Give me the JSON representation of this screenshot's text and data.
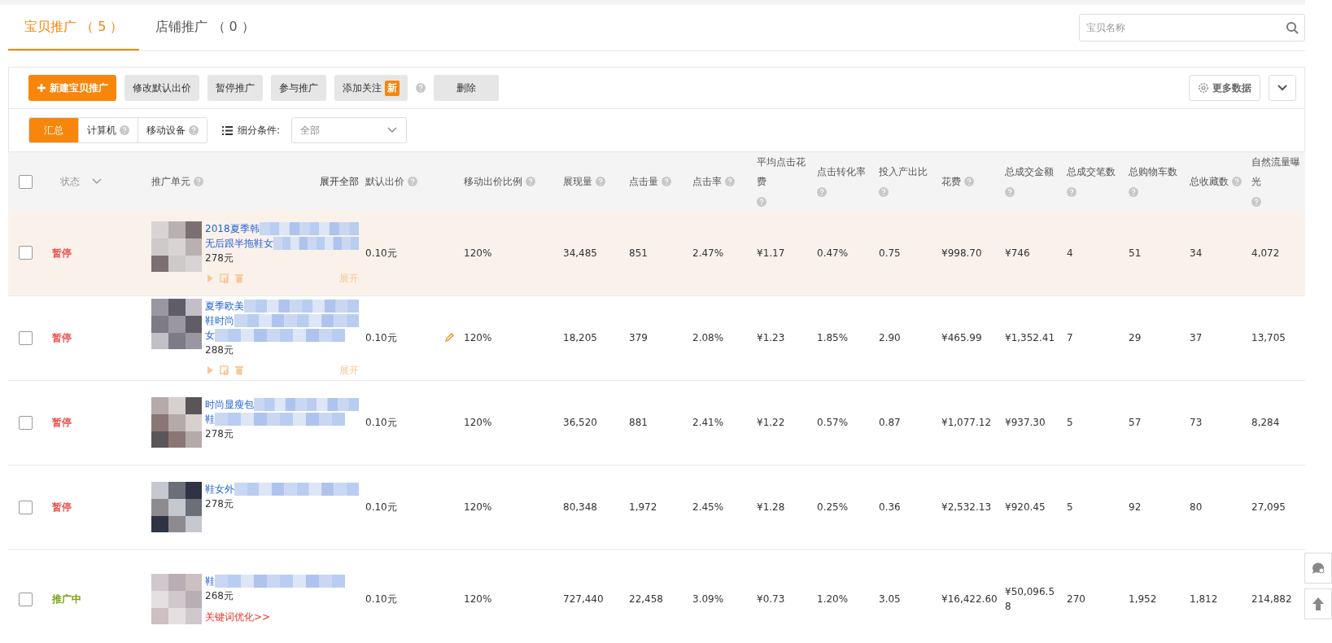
{
  "tabs": [
    {
      "label": "宝贝推广 （ 5 ）",
      "selected": true
    },
    {
      "label": "店铺推广 （ 0 ）",
      "selected": false
    }
  ],
  "search": {
    "placeholder": "宝贝名称"
  },
  "toolbar": {
    "buttons": [
      {
        "label": "新建宝贝推广",
        "kind": "primary"
      },
      {
        "label": "修改默认出价",
        "kind": "plain"
      },
      {
        "label": "暂停推广",
        "kind": "plain"
      },
      {
        "label": "参与推广",
        "kind": "plain"
      },
      {
        "label": "添加关注",
        "kind": "plain",
        "badge": "新",
        "help": true
      },
      {
        "label": "删除",
        "kind": "wide"
      }
    ],
    "more_data": "更多数据"
  },
  "segments": [
    {
      "label": "汇总",
      "selected": true,
      "help": false
    },
    {
      "label": "计算机",
      "selected": false,
      "help": true
    },
    {
      "label": "移动设备",
      "selected": false,
      "help": true
    }
  ],
  "filter": {
    "label": "细分条件:",
    "value": "全部"
  },
  "select_all": {
    "checked": false
  },
  "columns": [
    {
      "label": "状态",
      "kind": "status"
    },
    {
      "label": "推广单元",
      "kind": "unit",
      "help": true,
      "link": "展开全部"
    },
    {
      "label": "默认出价",
      "help": true
    },
    {
      "label": "移动出价比例",
      "help": true
    },
    {
      "label": "展现量",
      "help": true
    },
    {
      "label": "点击量",
      "help": true
    },
    {
      "label": "点击率",
      "help": true
    },
    {
      "label": "平均点击花费",
      "help": true
    },
    {
      "label": "点击转化率",
      "help": true
    },
    {
      "label": "投入产出比",
      "help": true
    },
    {
      "label": "花费",
      "help": true
    },
    {
      "label": "总成交金额",
      "help": true
    },
    {
      "label": "总成交笔数",
      "help": true
    },
    {
      "label": "总购物车数",
      "help": true
    },
    {
      "label": "总收藏数",
      "help": true
    },
    {
      "label": "自然流量曝光",
      "help": true
    }
  ],
  "rows": [
    {
      "checked": false,
      "highlighted": true,
      "status": "暂停",
      "active": false,
      "title_lines": [
        "2018夏季韩",
        "无后跟半拖鞋女"
      ],
      "price": "278元",
      "actions": true,
      "expand": "展开",
      "edit": false,
      "cells": [
        "0.10元",
        "120%",
        "34,485",
        "851",
        "2.47%",
        "¥1.17",
        "0.47%",
        "0.75",
        "¥998.70",
        "¥746",
        "4",
        "51",
        "34",
        "4,072"
      ]
    },
    {
      "checked": false,
      "highlighted": false,
      "status": "暂停",
      "active": false,
      "title_lines": [
        "夏季欧美",
        "鞋时尚",
        "女"
      ],
      "price": "288元",
      "actions": true,
      "expand": "展开",
      "edit": true,
      "cells": [
        "0.10元",
        "120%",
        "18,205",
        "379",
        "2.08%",
        "¥1.23",
        "1.85%",
        "2.90",
        "¥465.99",
        "¥1,352.41",
        "7",
        "29",
        "37",
        "13,705"
      ]
    },
    {
      "checked": false,
      "highlighted": false,
      "status": "暂停",
      "active": false,
      "title_lines": [
        "时尚显瘦包",
        "鞋"
      ],
      "price": "278元",
      "actions": false,
      "edit": false,
      "cells": [
        "0.10元",
        "120%",
        "36,520",
        "881",
        "2.41%",
        "¥1.22",
        "0.57%",
        "0.87",
        "¥1,077.12",
        "¥937.30",
        "5",
        "57",
        "73",
        "8,284"
      ]
    },
    {
      "checked": false,
      "highlighted": false,
      "status": "暂停",
      "active": false,
      "title_lines": [
        "鞋女外"
      ],
      "price": "278元",
      "actions": false,
      "edit": false,
      "cells": [
        "0.10元",
        "120%",
        "80,348",
        "1,972",
        "2.45%",
        "¥1.28",
        "0.25%",
        "0.36",
        "¥2,532.13",
        "¥920.45",
        "5",
        "92",
        "80",
        "27,095"
      ]
    },
    {
      "checked": false,
      "highlighted": false,
      "status": "推广中",
      "active": true,
      "title_lines": [
        "鞋"
      ],
      "price": "268元",
      "actions": false,
      "link": "关键词优化>>",
      "edit": false,
      "cells": [
        "0.10元",
        "120%",
        "727,440",
        "22,458",
        "3.09%",
        "¥0.73",
        "1.20%",
        "3.05",
        "¥16,422.60",
        "¥50,096.58",
        "270",
        "1,952",
        "1,812",
        "214,882"
      ]
    }
  ]
}
